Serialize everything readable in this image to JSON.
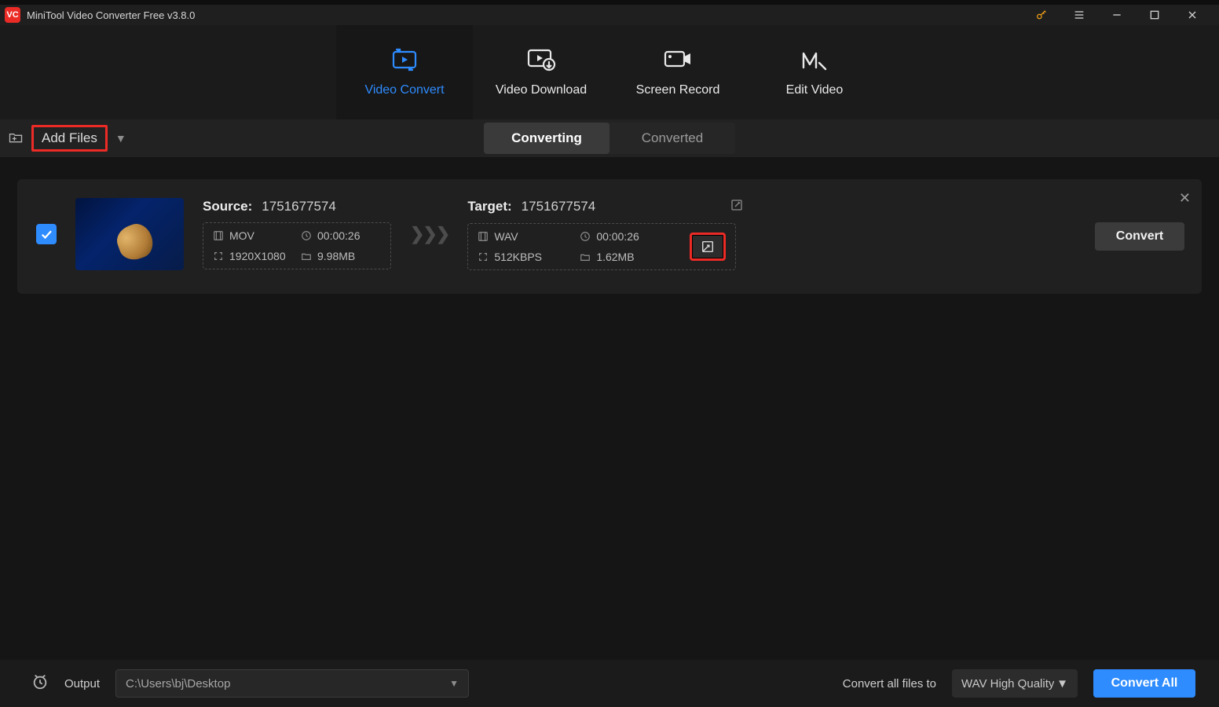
{
  "titlebar": {
    "app_title": "MiniTool Video Converter Free v3.8.0",
    "logo_text": "VC"
  },
  "nav": {
    "video_convert": "Video Convert",
    "video_download": "Video Download",
    "screen_record": "Screen Record",
    "edit_video": "Edit Video"
  },
  "toolbar": {
    "add_files": "Add Files",
    "subtab_converting": "Converting",
    "subtab_converted": "Converted"
  },
  "item": {
    "source_label": "Source:",
    "source_name": "1751677574",
    "source": {
      "format": "MOV",
      "duration": "00:00:26",
      "resolution": "1920X1080",
      "size": "9.98MB"
    },
    "target_label": "Target:",
    "target_name": "1751677574",
    "target": {
      "format": "WAV",
      "duration": "00:00:26",
      "bitrate": "512KBPS",
      "size": "1.62MB"
    },
    "convert_btn": "Convert"
  },
  "footer": {
    "output_label": "Output",
    "output_path": "C:\\Users\\bj\\Desktop",
    "convert_all_to_label": "Convert all files to",
    "preset": "WAV High Quality",
    "convert_all_btn": "Convert All"
  }
}
